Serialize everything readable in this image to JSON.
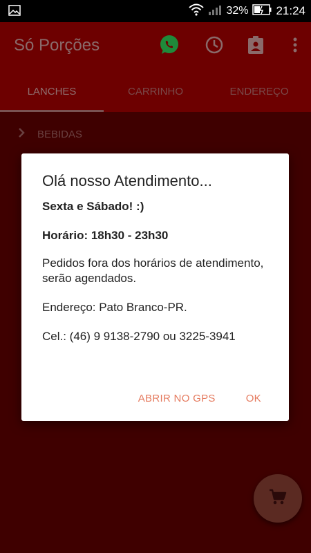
{
  "status_bar": {
    "battery_percent": "32%",
    "time": "21:24"
  },
  "app_bar": {
    "title": "Só Porções"
  },
  "tabs": [
    {
      "label": "LANCHES",
      "active": true
    },
    {
      "label": "CARRINHO",
      "active": false
    },
    {
      "label": "ENDEREÇO",
      "active": false
    }
  ],
  "content": {
    "category": "BEBIDAS"
  },
  "dialog": {
    "title": "Olá nosso Atendimento...",
    "line1": "Sexta e Sábado! :)",
    "line2": "Horário: 18h30 - 23h30",
    "line3": "Pedidos fora dos horários de atendimento, serão agendados.",
    "line4": "Endereço: Pato Branco-PR.",
    "line5": "Cel.: (46) 9 9138-2790 ou 3225-3941",
    "button_gps": "ABRIR NO GPS",
    "button_ok": "OK"
  },
  "colors": {
    "accent": "#e57a5e",
    "app_bar": "#6d0000",
    "background": "#3f0000"
  }
}
